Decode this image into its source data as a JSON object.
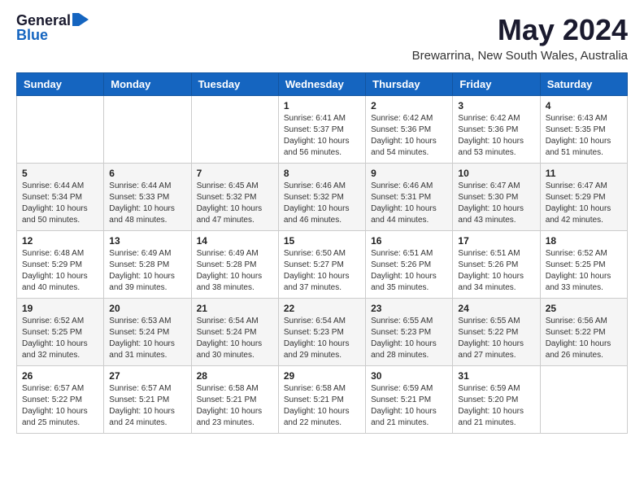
{
  "header": {
    "logo_general": "General",
    "logo_blue": "Blue",
    "month": "May 2024",
    "location": "Brewarrina, New South Wales, Australia"
  },
  "weekdays": [
    "Sunday",
    "Monday",
    "Tuesday",
    "Wednesday",
    "Thursday",
    "Friday",
    "Saturday"
  ],
  "weeks": [
    [
      {
        "day": "",
        "info": ""
      },
      {
        "day": "",
        "info": ""
      },
      {
        "day": "",
        "info": ""
      },
      {
        "day": "1",
        "info": "Sunrise: 6:41 AM\nSunset: 5:37 PM\nDaylight: 10 hours\nand 56 minutes."
      },
      {
        "day": "2",
        "info": "Sunrise: 6:42 AM\nSunset: 5:36 PM\nDaylight: 10 hours\nand 54 minutes."
      },
      {
        "day": "3",
        "info": "Sunrise: 6:42 AM\nSunset: 5:36 PM\nDaylight: 10 hours\nand 53 minutes."
      },
      {
        "day": "4",
        "info": "Sunrise: 6:43 AM\nSunset: 5:35 PM\nDaylight: 10 hours\nand 51 minutes."
      }
    ],
    [
      {
        "day": "5",
        "info": "Sunrise: 6:44 AM\nSunset: 5:34 PM\nDaylight: 10 hours\nand 50 minutes."
      },
      {
        "day": "6",
        "info": "Sunrise: 6:44 AM\nSunset: 5:33 PM\nDaylight: 10 hours\nand 48 minutes."
      },
      {
        "day": "7",
        "info": "Sunrise: 6:45 AM\nSunset: 5:32 PM\nDaylight: 10 hours\nand 47 minutes."
      },
      {
        "day": "8",
        "info": "Sunrise: 6:46 AM\nSunset: 5:32 PM\nDaylight: 10 hours\nand 46 minutes."
      },
      {
        "day": "9",
        "info": "Sunrise: 6:46 AM\nSunset: 5:31 PM\nDaylight: 10 hours\nand 44 minutes."
      },
      {
        "day": "10",
        "info": "Sunrise: 6:47 AM\nSunset: 5:30 PM\nDaylight: 10 hours\nand 43 minutes."
      },
      {
        "day": "11",
        "info": "Sunrise: 6:47 AM\nSunset: 5:29 PM\nDaylight: 10 hours\nand 42 minutes."
      }
    ],
    [
      {
        "day": "12",
        "info": "Sunrise: 6:48 AM\nSunset: 5:29 PM\nDaylight: 10 hours\nand 40 minutes."
      },
      {
        "day": "13",
        "info": "Sunrise: 6:49 AM\nSunset: 5:28 PM\nDaylight: 10 hours\nand 39 minutes."
      },
      {
        "day": "14",
        "info": "Sunrise: 6:49 AM\nSunset: 5:28 PM\nDaylight: 10 hours\nand 38 minutes."
      },
      {
        "day": "15",
        "info": "Sunrise: 6:50 AM\nSunset: 5:27 PM\nDaylight: 10 hours\nand 37 minutes."
      },
      {
        "day": "16",
        "info": "Sunrise: 6:51 AM\nSunset: 5:26 PM\nDaylight: 10 hours\nand 35 minutes."
      },
      {
        "day": "17",
        "info": "Sunrise: 6:51 AM\nSunset: 5:26 PM\nDaylight: 10 hours\nand 34 minutes."
      },
      {
        "day": "18",
        "info": "Sunrise: 6:52 AM\nSunset: 5:25 PM\nDaylight: 10 hours\nand 33 minutes."
      }
    ],
    [
      {
        "day": "19",
        "info": "Sunrise: 6:52 AM\nSunset: 5:25 PM\nDaylight: 10 hours\nand 32 minutes."
      },
      {
        "day": "20",
        "info": "Sunrise: 6:53 AM\nSunset: 5:24 PM\nDaylight: 10 hours\nand 31 minutes."
      },
      {
        "day": "21",
        "info": "Sunrise: 6:54 AM\nSunset: 5:24 PM\nDaylight: 10 hours\nand 30 minutes."
      },
      {
        "day": "22",
        "info": "Sunrise: 6:54 AM\nSunset: 5:23 PM\nDaylight: 10 hours\nand 29 minutes."
      },
      {
        "day": "23",
        "info": "Sunrise: 6:55 AM\nSunset: 5:23 PM\nDaylight: 10 hours\nand 28 minutes."
      },
      {
        "day": "24",
        "info": "Sunrise: 6:55 AM\nSunset: 5:22 PM\nDaylight: 10 hours\nand 27 minutes."
      },
      {
        "day": "25",
        "info": "Sunrise: 6:56 AM\nSunset: 5:22 PM\nDaylight: 10 hours\nand 26 minutes."
      }
    ],
    [
      {
        "day": "26",
        "info": "Sunrise: 6:57 AM\nSunset: 5:22 PM\nDaylight: 10 hours\nand 25 minutes."
      },
      {
        "day": "27",
        "info": "Sunrise: 6:57 AM\nSunset: 5:21 PM\nDaylight: 10 hours\nand 24 minutes."
      },
      {
        "day": "28",
        "info": "Sunrise: 6:58 AM\nSunset: 5:21 PM\nDaylight: 10 hours\nand 23 minutes."
      },
      {
        "day": "29",
        "info": "Sunrise: 6:58 AM\nSunset: 5:21 PM\nDaylight: 10 hours\nand 22 minutes."
      },
      {
        "day": "30",
        "info": "Sunrise: 6:59 AM\nSunset: 5:21 PM\nDaylight: 10 hours\nand 21 minutes."
      },
      {
        "day": "31",
        "info": "Sunrise: 6:59 AM\nSunset: 5:20 PM\nDaylight: 10 hours\nand 21 minutes."
      },
      {
        "day": "",
        "info": ""
      }
    ]
  ]
}
